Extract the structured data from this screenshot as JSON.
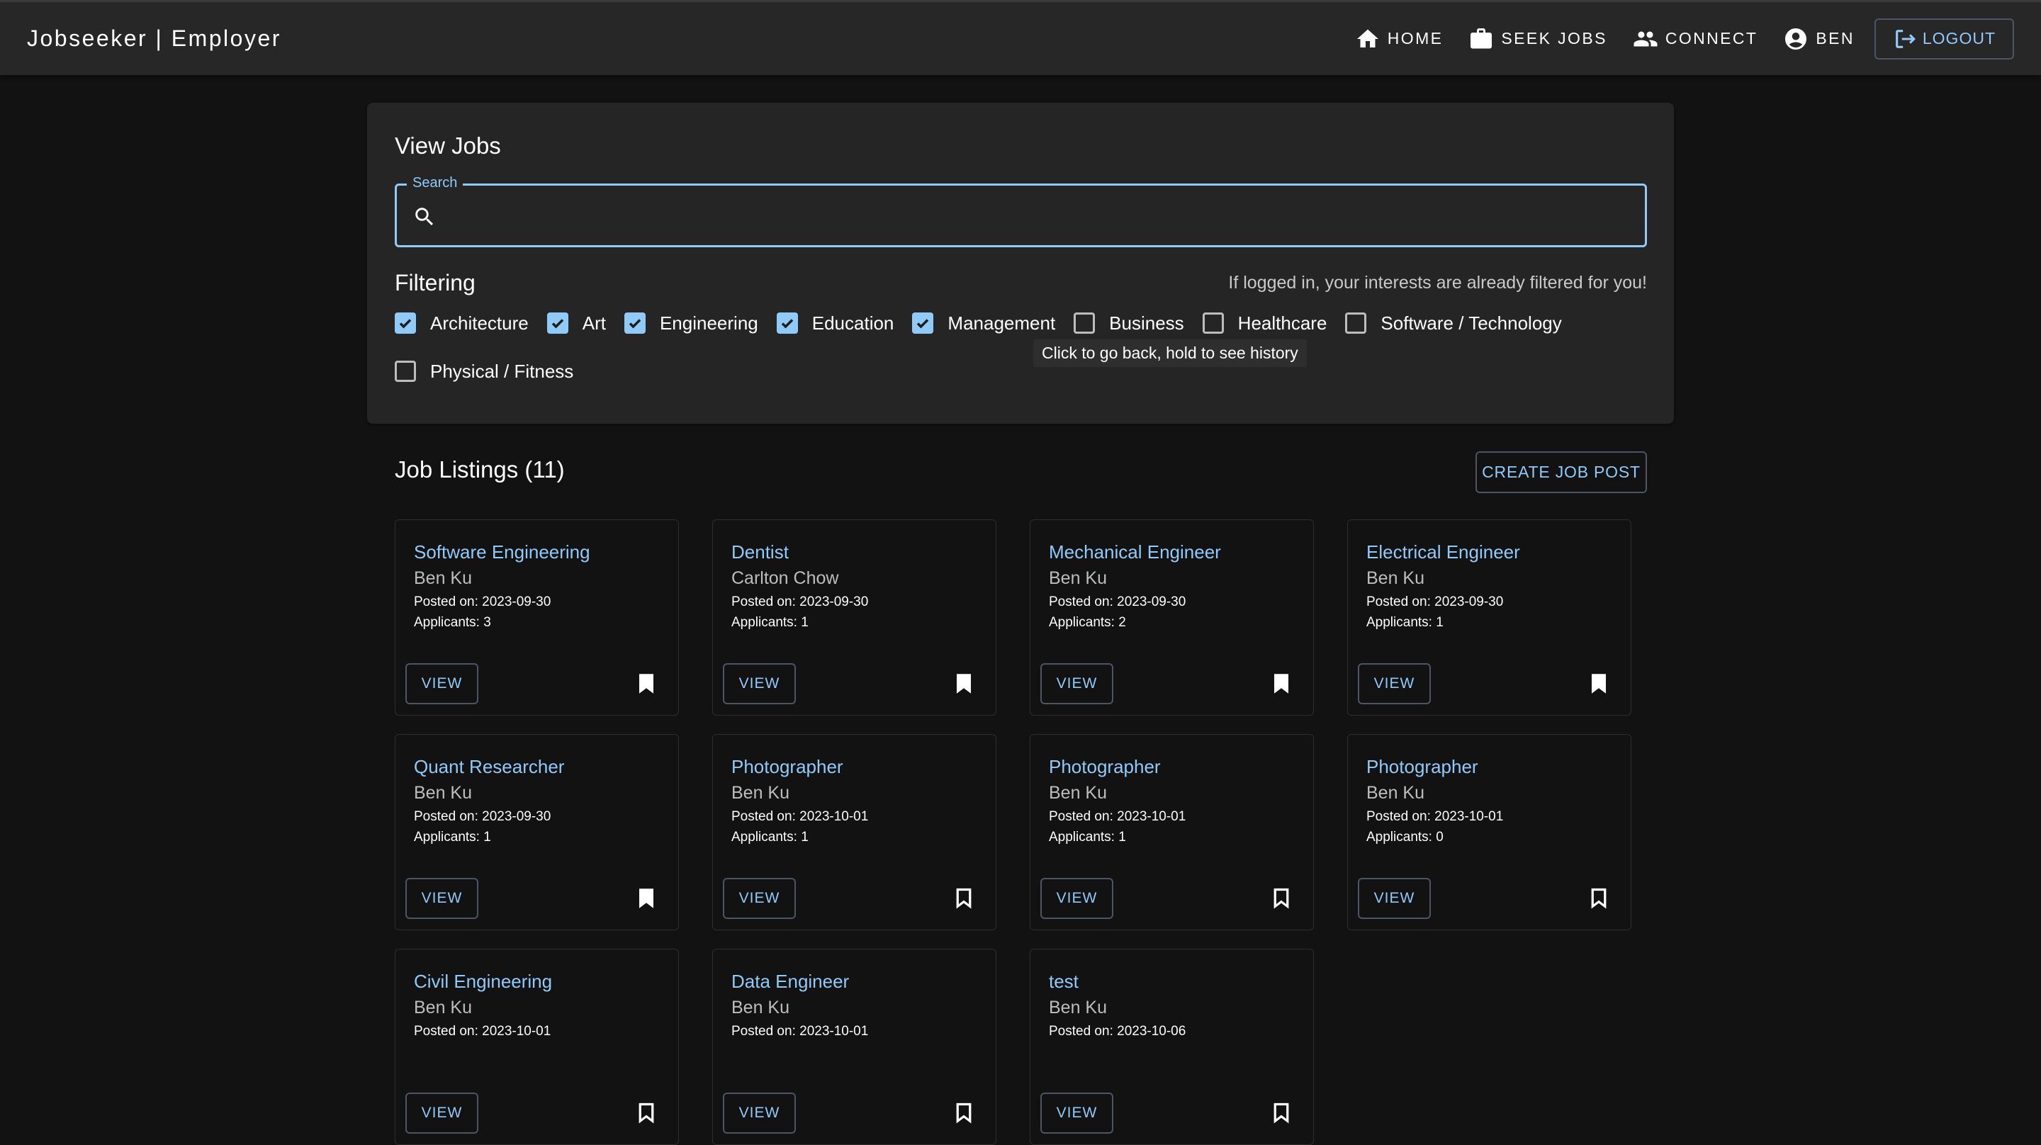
{
  "header": {
    "brand": "Jobseeker | Employer",
    "nav": [
      {
        "label": "HOME",
        "icon": "home-icon"
      },
      {
        "label": "SEEK JOBS",
        "icon": "briefcase-icon"
      },
      {
        "label": "CONNECT",
        "icon": "people-icon"
      },
      {
        "label": "BEN",
        "icon": "account-circle-icon"
      }
    ],
    "logout_label": "LOGOUT"
  },
  "search_panel": {
    "title": "View Jobs",
    "search_label": "Search",
    "search_value": "",
    "filtering_title": "Filtering",
    "hint": "If logged in, your interests are already filtered for you!",
    "filters": [
      {
        "label": "Architecture",
        "checked": true
      },
      {
        "label": "Art",
        "checked": true
      },
      {
        "label": "Engineering",
        "checked": true
      },
      {
        "label": "Education",
        "checked": true
      },
      {
        "label": "Management",
        "checked": true
      },
      {
        "label": "Business",
        "checked": false
      },
      {
        "label": "Healthcare",
        "checked": false
      },
      {
        "label": "Software / Technology",
        "checked": false
      },
      {
        "label": "Physical / Fitness",
        "checked": false
      }
    ]
  },
  "tooltip": "Click to go back, hold to see history",
  "listings": {
    "heading": "Job Listings (11)",
    "create_label": "CREATE JOB POST",
    "view_label": "VIEW",
    "jobs": [
      {
        "title": "Software Engineering",
        "author": "Ben Ku",
        "posted": "Posted on: 2023-09-30",
        "applicants": "Applicants: 3",
        "bookmarked": true
      },
      {
        "title": "Dentist",
        "author": "Carlton Chow",
        "posted": "Posted on: 2023-09-30",
        "applicants": "Applicants: 1",
        "bookmarked": true
      },
      {
        "title": "Mechanical Engineer",
        "author": "Ben Ku",
        "posted": "Posted on: 2023-09-30",
        "applicants": "Applicants: 2",
        "bookmarked": true
      },
      {
        "title": "Electrical Engineer",
        "author": "Ben Ku",
        "posted": "Posted on: 2023-09-30",
        "applicants": "Applicants: 1",
        "bookmarked": true
      },
      {
        "title": "Quant Researcher",
        "author": "Ben Ku",
        "posted": "Posted on: 2023-09-30",
        "applicants": "Applicants: 1",
        "bookmarked": true
      },
      {
        "title": "Photographer",
        "author": "Ben Ku",
        "posted": "Posted on: 2023-10-01",
        "applicants": "Applicants: 1",
        "bookmarked": false
      },
      {
        "title": "Photographer",
        "author": "Ben Ku",
        "posted": "Posted on: 2023-10-01",
        "applicants": "Applicants: 1",
        "bookmarked": false
      },
      {
        "title": "Photographer",
        "author": "Ben Ku",
        "posted": "Posted on: 2023-10-01",
        "applicants": "Applicants: 0",
        "bookmarked": false
      },
      {
        "title": "Civil Engineering",
        "author": "Ben Ku",
        "posted": "Posted on: 2023-10-01",
        "applicants": "",
        "bookmarked": false
      },
      {
        "title": "Data Engineer",
        "author": "Ben Ku",
        "posted": "Posted on: 2023-10-01",
        "applicants": "",
        "bookmarked": false
      },
      {
        "title": "test",
        "author": "Ben Ku",
        "posted": "Posted on: 2023-10-06",
        "applicants": "",
        "bookmarked": false
      }
    ]
  },
  "colors": {
    "accent": "#90caf9",
    "appbar": "#272727",
    "panel": "#252525",
    "background": "#121212"
  }
}
